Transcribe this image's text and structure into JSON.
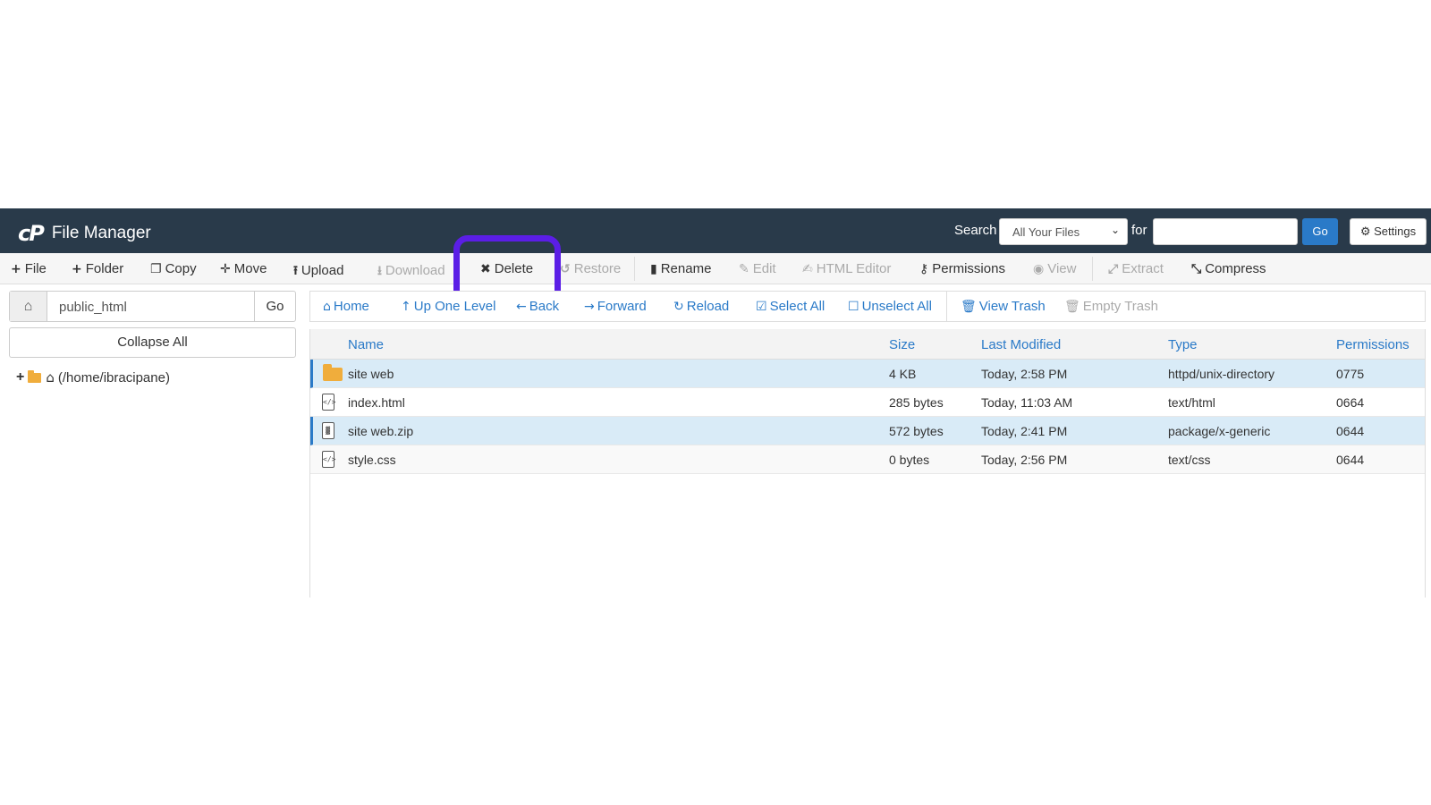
{
  "header": {
    "logo": "cP",
    "title": "File Manager",
    "search_label": "Search",
    "search_scope": "All Your Files",
    "for_label": "for",
    "search_value": "",
    "go_label": "Go",
    "settings_label": "Settings"
  },
  "toolbar": {
    "file": "File",
    "folder": "Folder",
    "copy": "Copy",
    "move": "Move",
    "upload": "Upload",
    "download": "Download",
    "delete": "Delete",
    "restore": "Restore",
    "rename": "Rename",
    "edit": "Edit",
    "html_editor": "HTML Editor",
    "permissions": "Permissions",
    "view": "View",
    "extract": "Extract",
    "compress": "Compress"
  },
  "sidebar": {
    "path_value": "public_html",
    "go_label": "Go",
    "collapse_label": "Collapse All",
    "tree_root": "(/home/ibracipane)"
  },
  "nav": {
    "home": "Home",
    "up_one_level": "Up One Level",
    "back": "Back",
    "forward": "Forward",
    "reload": "Reload",
    "select_all": "Select All",
    "unselect_all": "Unselect All",
    "view_trash": "View Trash",
    "empty_trash": "Empty Trash"
  },
  "table": {
    "headers": {
      "name": "Name",
      "size": "Size",
      "modified": "Last Modified",
      "type": "Type",
      "permissions": "Permissions"
    },
    "rows": [
      {
        "name": "site web",
        "size": "4 KB",
        "modified": "Today, 2:58 PM",
        "type": "httpd/unix-directory",
        "perms": "0775",
        "icon": "folder-icon",
        "selected": true
      },
      {
        "name": "index.html",
        "size": "285 bytes",
        "modified": "Today, 11:03 AM",
        "type": "text/html",
        "perms": "0664",
        "icon": "code-file-icon",
        "selected": false
      },
      {
        "name": "site web.zip",
        "size": "572 bytes",
        "modified": "Today, 2:41 PM",
        "type": "package/x-generic",
        "perms": "0644",
        "icon": "zip-file-icon",
        "selected": true
      },
      {
        "name": "style.css",
        "size": "0 bytes",
        "modified": "Today, 2:56 PM",
        "type": "text/css",
        "perms": "0644",
        "icon": "code-file-icon",
        "selected": false
      }
    ]
  },
  "colors": {
    "header_bg": "#293a4a",
    "accent": "#2a7ac8",
    "highlight_ring": "#5b1ee6",
    "folder": "#f0ad3c",
    "selected_row": "#d9ebf7"
  }
}
